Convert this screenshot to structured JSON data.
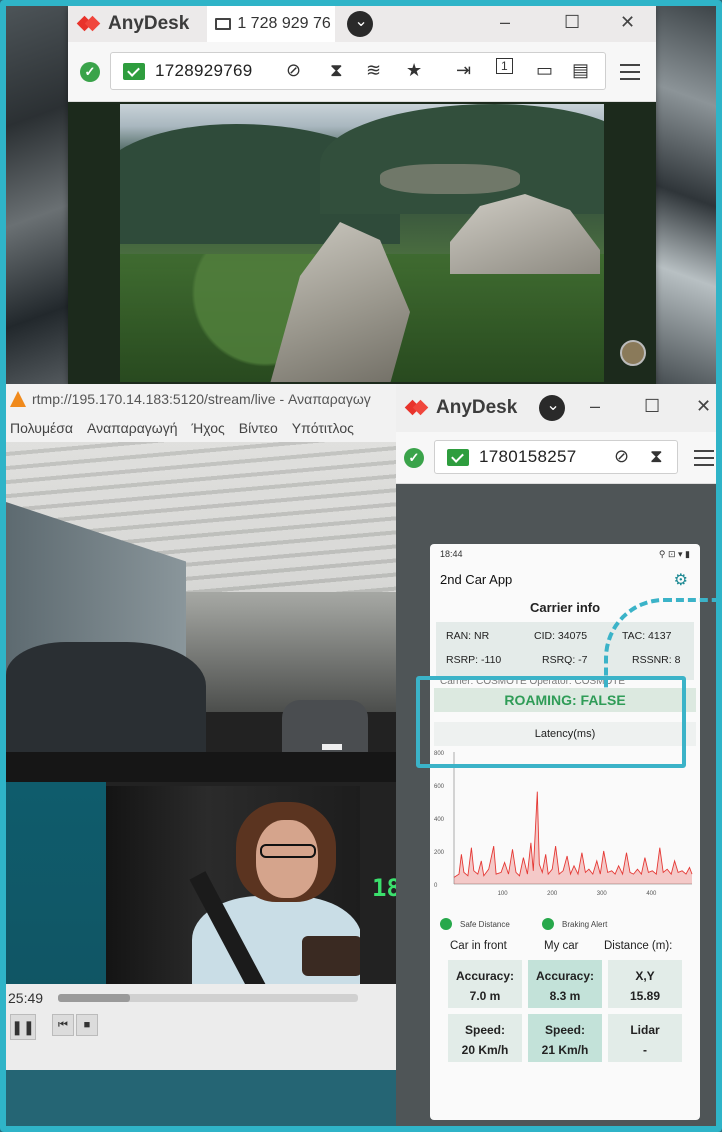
{
  "anydesk_main": {
    "brand": "AnyDesk",
    "tab_label": "1 728 929 76",
    "address": "1728929769",
    "minimize": "–",
    "maximize": "☐",
    "close": "✕"
  },
  "vlc": {
    "title": "rtmp://195.170.14.183:5120/stream/live - Αναπαραγωγ",
    "menu": [
      "Πολυμέσα",
      "Αναπαραγωγή",
      "Ήχος",
      "Βίντεο",
      "Υπότιτλος"
    ],
    "time": "25:49",
    "overlay_time": "18:",
    "progress": 0.24
  },
  "anydesk_second": {
    "brand": "AnyDesk",
    "address": "1780158257",
    "minimize": "–",
    "maximize": "☐",
    "close": "✕"
  },
  "phone": {
    "status_time": "18:44",
    "status_icons": "⚲ ⊡ ▾ ▮",
    "app_title": "2nd Car App",
    "carrier_header": "Carrier info",
    "ran": "RAN: NR",
    "cid": "CID: 34075",
    "tac": "TAC: 4137",
    "rsrp": "RSRP: -110",
    "rsrq": "RSRQ: -7",
    "rssnr": "RSSNR: 8",
    "carrier_row": "Carrier: COSMOTE     Operator: COSMOTE",
    "roaming": "ROAMING: FALSE",
    "latency_label": "Latency(ms)",
    "legend_safe": "Safe Distance",
    "legend_braking": "Braking Alert",
    "col_car_front": "Car in front",
    "col_my_car": "My car",
    "col_distance": "Distance (m):",
    "accuracy_front_label": "Accuracy:",
    "accuracy_front_value": "7.0 m",
    "accuracy_my_label": "Accuracy:",
    "accuracy_my_value": "8.3 m",
    "xy_label": "X,Y",
    "xy_value": "15.89",
    "speed_front_label": "Speed:",
    "speed_front_value": "20 Km/h",
    "speed_my_label": "Speed:",
    "speed_my_value": "21 Km/h",
    "lidar_label": "Lidar",
    "lidar_value": "-"
  },
  "colors": {
    "frame": "#2fb4c8",
    "anydesk_red": "#e8332b",
    "status_green": "#3aa34a",
    "roaming_green": "#2f9c57",
    "latency_line": "#e53935"
  },
  "chart_data": {
    "type": "line",
    "title": "Latency(ms)",
    "xlabel": "",
    "ylabel": "",
    "ylim": [
      0,
      800
    ],
    "xlim": [
      0,
      480
    ],
    "yticks": [
      0,
      200,
      400,
      600,
      800
    ],
    "xticks": [
      100,
      200,
      300,
      400
    ],
    "series": [
      {
        "values": [
          [
            0,
            40
          ],
          [
            10,
            60
          ],
          [
            15,
            180
          ],
          [
            20,
            70
          ],
          [
            28,
            50
          ],
          [
            35,
            220
          ],
          [
            40,
            80
          ],
          [
            48,
            60
          ],
          [
            55,
            140
          ],
          [
            60,
            50
          ],
          [
            70,
            90
          ],
          [
            80,
            230
          ],
          [
            85,
            60
          ],
          [
            95,
            70
          ],
          [
            102,
            130
          ],
          [
            110,
            60
          ],
          [
            118,
            210
          ],
          [
            125,
            70
          ],
          [
            132,
            50
          ],
          [
            140,
            160
          ],
          [
            148,
            60
          ],
          [
            155,
            250
          ],
          [
            160,
            80
          ],
          [
            168,
            560
          ],
          [
            172,
            120
          ],
          [
            178,
            70
          ],
          [
            185,
            180
          ],
          [
            190,
            60
          ],
          [
            198,
            90
          ],
          [
            205,
            230
          ],
          [
            212,
            60
          ],
          [
            220,
            80
          ],
          [
            228,
            170
          ],
          [
            235,
            60
          ],
          [
            242,
            110
          ],
          [
            250,
            60
          ],
          [
            258,
            190
          ],
          [
            265,
            70
          ],
          [
            272,
            90
          ],
          [
            280,
            60
          ],
          [
            288,
            140
          ],
          [
            295,
            60
          ],
          [
            302,
            200
          ],
          [
            310,
            70
          ],
          [
            318,
            80
          ],
          [
            325,
            60
          ],
          [
            332,
            110
          ],
          [
            340,
            60
          ],
          [
            348,
            190
          ],
          [
            355,
            70
          ],
          [
            362,
            60
          ],
          [
            370,
            90
          ],
          [
            378,
            60
          ],
          [
            385,
            160
          ],
          [
            392,
            70
          ],
          [
            400,
            80
          ],
          [
            408,
            60
          ],
          [
            415,
            220
          ],
          [
            422,
            70
          ],
          [
            430,
            90
          ],
          [
            438,
            60
          ],
          [
            445,
            140
          ],
          [
            452,
            70
          ],
          [
            460,
            80
          ],
          [
            468,
            60
          ],
          [
            475,
            100
          ],
          [
            480,
            60
          ]
        ]
      }
    ],
    "grid": false
  }
}
